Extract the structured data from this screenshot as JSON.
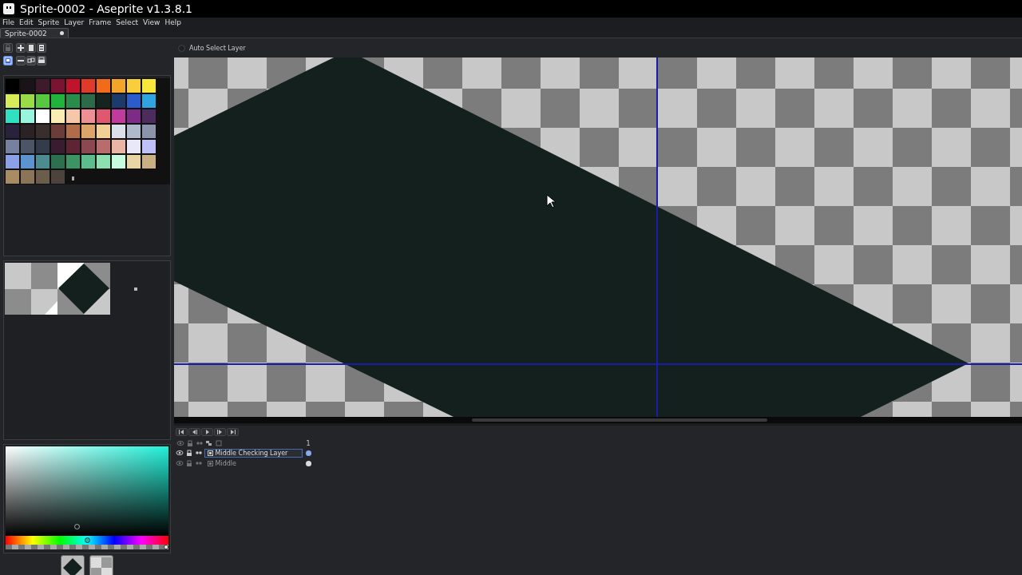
{
  "window": {
    "title": "Sprite-0002 - Aseprite v1.3.8.1"
  },
  "menu": [
    "File",
    "Edit",
    "Sprite",
    "Layer",
    "Frame",
    "Select",
    "View",
    "Help"
  ],
  "tabs": [
    {
      "label": "Sprite-0002",
      "selected": true,
      "modified": true
    }
  ],
  "palette_tools": [
    {
      "kind": "lock",
      "disabled": true,
      "selected": false
    },
    {
      "kind": "add",
      "disabled": false,
      "selected": false
    },
    {
      "kind": "page",
      "disabled": false,
      "selected": false
    },
    {
      "kind": "list",
      "disabled": false,
      "selected": false
    },
    {
      "kind": "edit",
      "disabled": false,
      "selected": true
    },
    {
      "kind": "minus",
      "disabled": false,
      "selected": false
    },
    {
      "kind": "link",
      "disabled": false,
      "selected": false
    },
    {
      "kind": "print",
      "disabled": false,
      "selected": false
    }
  ],
  "palette": [
    {
      "color": "#000000"
    },
    {
      "color": "#1a1416"
    },
    {
      "color": "#3e1b2a"
    },
    {
      "color": "#7a1433"
    },
    {
      "color": "#c0142c"
    },
    {
      "color": "#e03a2a"
    },
    {
      "color": "#f06c1c"
    },
    {
      "color": "#f2a52a"
    },
    {
      "color": "#f8ce3c"
    },
    {
      "color": "#f8e83c"
    },
    {
      "color": "#d8ec5a"
    },
    {
      "color": "#9adc48"
    },
    {
      "color": "#58c840"
    },
    {
      "color": "#20b43c"
    },
    {
      "color": "#288c4a"
    },
    {
      "color": "#2c6a48"
    },
    {
      "color": "#162420"
    },
    {
      "color": "#1c3a6a"
    },
    {
      "color": "#2c5ccc"
    },
    {
      "color": "#30a4e0"
    },
    {
      "color": "#30e0c0"
    },
    {
      "color": "#98f4dc"
    },
    {
      "color": "#ffffff"
    },
    {
      "color": "#fcecb4"
    },
    {
      "color": "#f4c8a8"
    },
    {
      "color": "#ec9094"
    },
    {
      "color": "#e05870"
    },
    {
      "color": "#c03c9c"
    },
    {
      "color": "#7c2c84"
    },
    {
      "color": "#4c2c5c"
    },
    {
      "color": "#28223a"
    },
    {
      "color": "#2a2224"
    },
    {
      "color": "#3a2e2c"
    },
    {
      "color": "#6c3c38"
    },
    {
      "color": "#b06c48"
    },
    {
      "color": "#dca468"
    },
    {
      "color": "#f0d094"
    },
    {
      "color": "#dce0e8"
    },
    {
      "color": "#b0b8cc"
    },
    {
      "color": "#8c94ac"
    },
    {
      "color": "#7880a0"
    },
    {
      "color": "#4c5468"
    },
    {
      "color": "#343c4c"
    },
    {
      "color": "#3a1c30"
    },
    {
      "color": "#5e2434"
    },
    {
      "color": "#8c4850"
    },
    {
      "color": "#b86c6c"
    },
    {
      "color": "#ecb4a4"
    },
    {
      "color": "#e8e8f8"
    },
    {
      "color": "#c0c0f8"
    },
    {
      "color": "#8ca0e8"
    },
    {
      "color": "#5c94d0"
    },
    {
      "color": "#4c8c90"
    },
    {
      "color": "#2c7050"
    },
    {
      "color": "#3c9464"
    },
    {
      "color": "#5cbc8c"
    },
    {
      "color": "#8ce0b0"
    },
    {
      "color": "#c8fce0"
    },
    {
      "color": "#e8d4a4"
    },
    {
      "color": "#c8b084"
    },
    {
      "color": "#a88c64"
    },
    {
      "color": "#8c7458"
    },
    {
      "color": "#6c5c4c"
    },
    {
      "color": "#4c443c"
    }
  ],
  "context_bar": {
    "auto_select_layer": {
      "label": "Auto Select Layer",
      "checked": false
    }
  },
  "color_picker": {
    "hue": {
      "level": 0.5
    },
    "alpha": {
      "level": 1
    }
  },
  "timeline": {
    "frames": [
      "1"
    ],
    "layers": [
      {
        "name": "Middle Checking Layer",
        "visible": true,
        "selected": true
      },
      {
        "name": "Middle",
        "visible": false,
        "selected": false
      }
    ]
  }
}
